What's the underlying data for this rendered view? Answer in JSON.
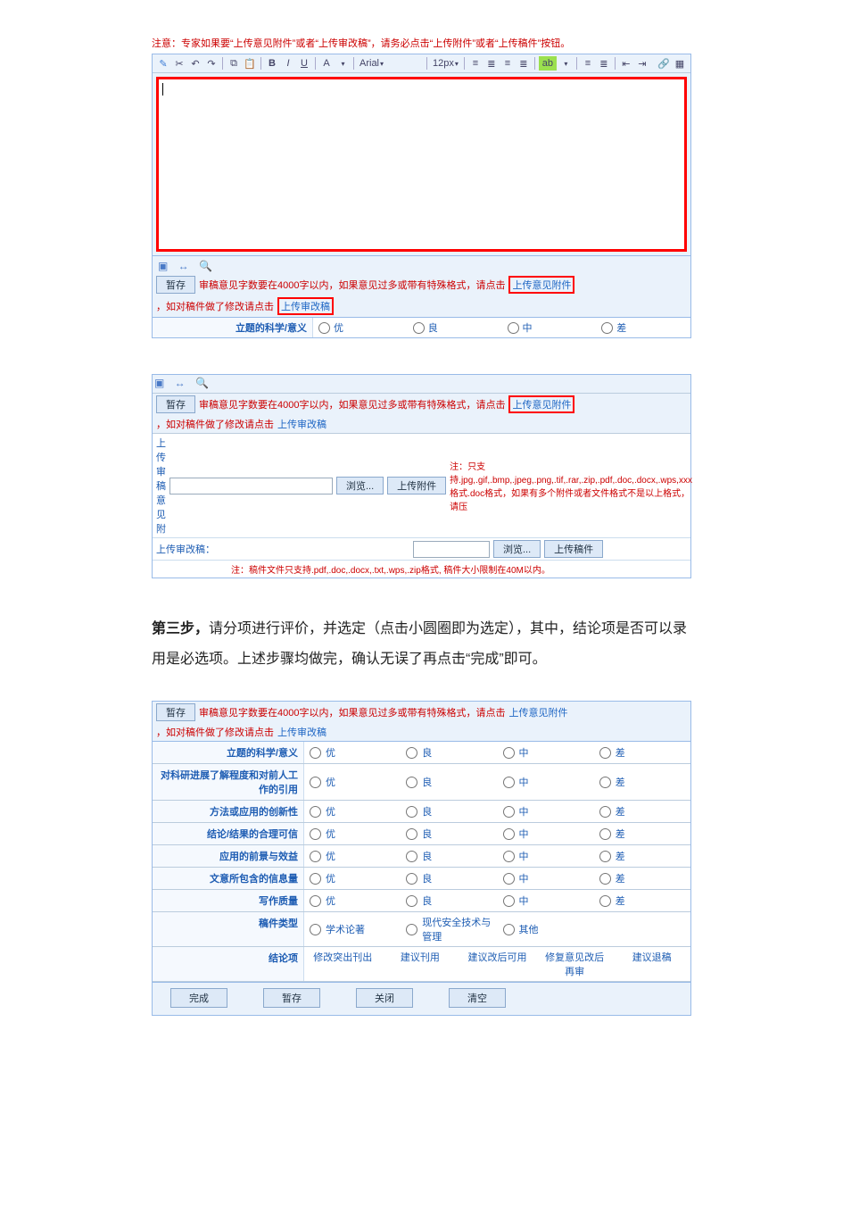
{
  "top_note": "注意：专家如果要“上传意见附件”或者“上传审改稿”，请务必点击“上传附件”或者“上传稿件”按钮。",
  "toolbar": {
    "font_name": "Arial",
    "font_size": "12px"
  },
  "save_btn": "暂存",
  "hint1_a": "审稿意见字数要在4000字以内，如果意见过多或带有特殊格式，请点击",
  "hint1_link1": "上传意见附件",
  "hint1_b": "，如对稿件做了修改请点击",
  "hint1_link2": "上传审改稿",
  "rating_label": "立题的科学/意义",
  "rating_opts": [
    "优",
    "良",
    "中",
    "差"
  ],
  "upload": {
    "row1_label": "上传审稿意见附",
    "browse": "浏览...",
    "upload_attach": "上传附件",
    "row1_note": "注：只支持.jpg,.gif,.bmp,.jpeg,.png,.tif,.rar,.zip,.pdf,.doc,.docx,.wps,xxx格式.doc格式，如果有多个附件或者文件格式不是以上格式，请压",
    "row2_label": "上传审改稿：",
    "upload_file": "上传稿件",
    "row2_note": "注：稿件文件只支持.pdf,.doc,.docx,.txt,.wps,.zip格式, 稿件大小限制在40M以内。"
  },
  "para": {
    "lead": "第三步，",
    "text": "请分项进行评价，并选定（点击小圆圈即为选定），其中，结论项是否可以录用是必选项。上述步骤均做完，确认无误了再点击“完成”即可。"
  },
  "eval": {
    "rows": [
      "立题的科学/意义",
      "对科研进展了解程度和对前人工作的引用",
      "方法或应用的创新性",
      "结论/结果的合理可信",
      "应用的前景与效益",
      "文意所包含的信息量",
      "写作质量"
    ],
    "opts": [
      "优",
      "良",
      "中",
      "差"
    ],
    "type_label": "稿件类型",
    "type_opts": [
      "学术论著",
      "现代安全技术与管理",
      "其他"
    ],
    "concl_label": "结论项",
    "concl_opts": [
      "修改突出刊出",
      "建议刊用",
      "建议改后可用",
      "修复意见改后再审",
      "建议退稿"
    ]
  },
  "actions": {
    "finish": "完成",
    "save": "暂存",
    "close": "关闭",
    "clear": "清空"
  }
}
